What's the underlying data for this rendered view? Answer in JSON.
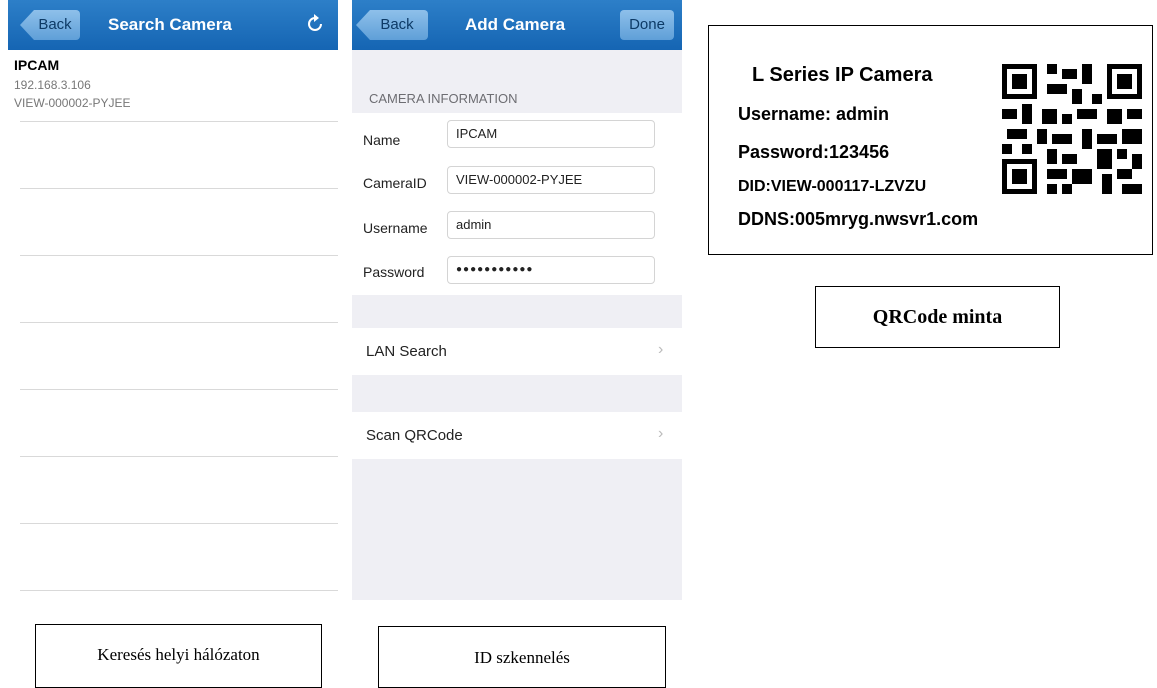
{
  "search_screen": {
    "back_label": "Back",
    "title": "Search Camera",
    "refresh_icon": "refresh-icon",
    "result": {
      "name": "IPCAM",
      "ip": "192.168.3.106",
      "id": "VIEW-000002-PYJEE"
    },
    "caption": "Keresés helyi hálózaton"
  },
  "add_screen": {
    "back_label": "Back",
    "title": "Add Camera",
    "done_label": "Done",
    "section_header": "CAMERA INFORMATION",
    "fields": {
      "name_label": "Name",
      "name_value": "IPCAM",
      "cameraid_label": "CameraID",
      "cameraid_value": "VIEW-000002-PYJEE",
      "username_label": "Username",
      "username_value": "admin",
      "password_label": "Password",
      "password_value": "●●●●●●●●●●●"
    },
    "lan_search_label": "LAN Search",
    "scan_qr_label": "Scan QRCode",
    "caption": "ID szkennelés"
  },
  "qr_card": {
    "line1": "L Series IP Camera",
    "line2": "Username: admin",
    "line3": "Password:123456",
    "line4": "DID:VIEW-000117-LZVZU",
    "line5": "DDNS:005mryg.nwsvr1.com",
    "caption": "QRCode minta"
  }
}
